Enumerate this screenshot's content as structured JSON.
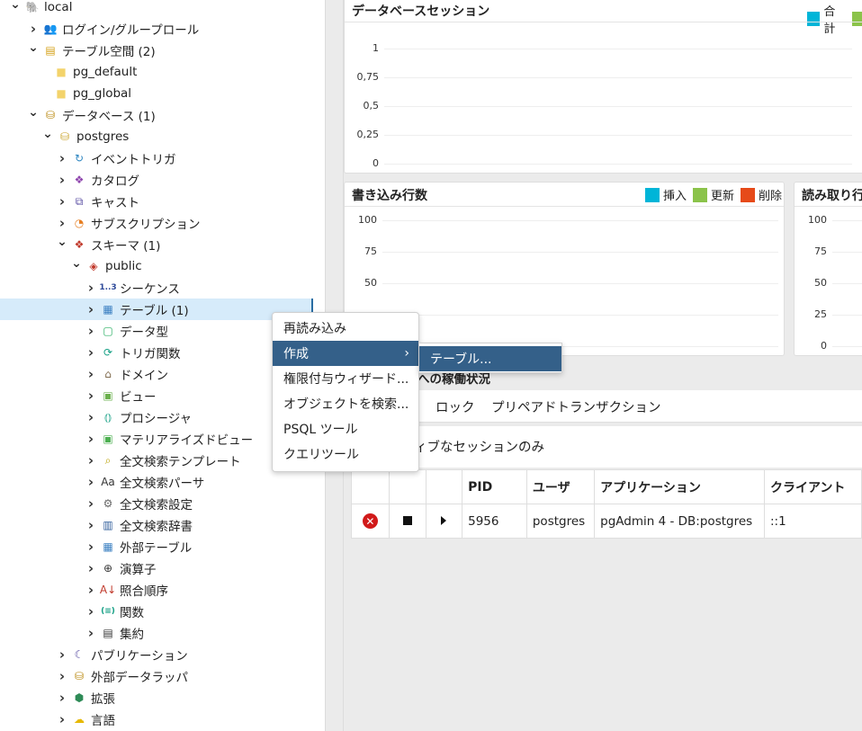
{
  "tree": {
    "items": [
      {
        "label": "local",
        "chev": "down",
        "icon": "postgres-elephant-icon",
        "glyph": "🐘",
        "color": "#336791",
        "indent": 10
      },
      {
        "label": "ログイン/グループロール",
        "chev": "right",
        "icon": "roles-icon",
        "glyph": "👥",
        "color": "#c0392b",
        "indent": 30
      },
      {
        "label": "テーブル空間 (2)",
        "chev": "down",
        "icon": "tablespaces-icon",
        "glyph": "▤",
        "color": "#d4a017",
        "indent": 30
      },
      {
        "label": "pg_default",
        "chev": "none",
        "icon": "folder-icon",
        "glyph": "■",
        "color": "#f3d36b",
        "indent": 42
      },
      {
        "label": "pg_global",
        "chev": "none",
        "icon": "folder-icon",
        "glyph": "■",
        "color": "#f3d36b",
        "indent": 42
      },
      {
        "label": "データベース (1)",
        "chev": "down",
        "icon": "databases-icon",
        "glyph": "⛁",
        "color": "#b8860b",
        "indent": 30
      },
      {
        "label": "postgres",
        "chev": "down",
        "icon": "database-icon",
        "glyph": "⛁",
        "color": "#c9a227",
        "indent": 46
      },
      {
        "label": "イベントトリガ",
        "chev": "right",
        "icon": "event-trigger-icon",
        "glyph": "↻",
        "color": "#2e86c1",
        "indent": 62
      },
      {
        "label": "カタログ",
        "chev": "right",
        "icon": "catalog-icon",
        "glyph": "❖",
        "color": "#8e44ad",
        "indent": 62
      },
      {
        "label": "キャスト",
        "chev": "right",
        "icon": "cast-icon",
        "glyph": "⧉",
        "color": "#5b4fa3",
        "indent": 62
      },
      {
        "label": "サブスクリプション",
        "chev": "right",
        "icon": "subscription-icon",
        "glyph": "◔",
        "color": "#e67e22",
        "indent": 62
      },
      {
        "label": "スキーマ (1)",
        "chev": "down",
        "icon": "schemas-icon",
        "glyph": "❖",
        "color": "#c0392b",
        "indent": 62
      },
      {
        "label": "public",
        "chev": "down",
        "icon": "schema-icon",
        "glyph": "◈",
        "color": "#c0392b",
        "indent": 78
      },
      {
        "label": "シーケンス",
        "chev": "right",
        "icon": "sequence-icon",
        "glyph": "1..3",
        "color": "#2e4a9a",
        "indent": 94
      },
      {
        "label": "テーブル (1)",
        "chev": "right",
        "icon": "table-icon",
        "glyph": "▦",
        "color": "#3a7fc1",
        "indent": 94,
        "selected": true
      },
      {
        "label": "データ型",
        "chev": "right",
        "icon": "datatype-icon",
        "glyph": "▢",
        "color": "#27ae60",
        "indent": 94
      },
      {
        "label": "トリガ関数",
        "chev": "right",
        "icon": "trigger-function-icon",
        "glyph": "⟳",
        "color": "#16a085",
        "indent": 94
      },
      {
        "label": "ドメイン",
        "chev": "right",
        "icon": "domain-icon",
        "glyph": "⌂",
        "color": "#7f6a4d",
        "indent": 94
      },
      {
        "label": "ビュー",
        "chev": "right",
        "icon": "view-icon",
        "glyph": "▣",
        "color": "#6ab04c",
        "indent": 94
      },
      {
        "label": "プロシージャ",
        "chev": "right",
        "icon": "procedure-icon",
        "glyph": "⦅⦆",
        "color": "#16a085",
        "indent": 94
      },
      {
        "label": "マテリアライズドビュー",
        "chev": "right",
        "icon": "materialized-view-icon",
        "glyph": "▣",
        "color": "#4caf50",
        "indent": 94
      },
      {
        "label": "全文検索テンプレート",
        "chev": "right",
        "icon": "fts-template-icon",
        "glyph": "⌕",
        "color": "#b9a000",
        "indent": 94
      },
      {
        "label": "全文検索パーサ",
        "chev": "right",
        "icon": "fts-parser-icon",
        "glyph": "Aa",
        "color": "#333333",
        "indent": 94
      },
      {
        "label": "全文検索設定",
        "chev": "right",
        "icon": "fts-config-icon",
        "glyph": "⚙",
        "color": "#666666",
        "indent": 94
      },
      {
        "label": "全文検索辞書",
        "chev": "right",
        "icon": "fts-dictionary-icon",
        "glyph": "▥",
        "color": "#2e5c9a",
        "indent": 94
      },
      {
        "label": "外部テーブル",
        "chev": "right",
        "icon": "foreign-table-icon",
        "glyph": "▦",
        "color": "#3a7fc1",
        "indent": 94
      },
      {
        "label": "演算子",
        "chev": "right",
        "icon": "operator-icon",
        "glyph": "⊕",
        "color": "#333333",
        "indent": 94
      },
      {
        "label": "照合順序",
        "chev": "right",
        "icon": "collation-icon",
        "glyph": "A↓",
        "color": "#c0392b",
        "indent": 94
      },
      {
        "label": "関数",
        "chev": "right",
        "icon": "function-icon",
        "glyph": "(≡)",
        "color": "#16a085",
        "indent": 94
      },
      {
        "label": "集約",
        "chev": "right",
        "icon": "aggregate-icon",
        "glyph": "▤",
        "color": "#333333",
        "indent": 94
      },
      {
        "label": "パブリケーション",
        "chev": "right",
        "icon": "publication-icon",
        "glyph": "☾",
        "color": "#5b4fa3",
        "indent": 62
      },
      {
        "label": "外部データラッパ",
        "chev": "right",
        "icon": "fdw-icon",
        "glyph": "⛁",
        "color": "#b8860b",
        "indent": 62
      },
      {
        "label": "拡張",
        "chev": "right",
        "icon": "extension-icon",
        "glyph": "⬢",
        "color": "#2e8b57",
        "indent": 62
      },
      {
        "label": "言語",
        "chev": "right",
        "icon": "language-icon",
        "glyph": "☁",
        "color": "#e6b800",
        "indent": 62
      }
    ]
  },
  "panels": {
    "sessions": {
      "title": "データベースセッション",
      "legend": [
        {
          "label": "合計",
          "color": "#00b5d8"
        },
        {
          "label": "",
          "color": "#8bc34a"
        }
      ],
      "ticks": [
        "1",
        "0,75",
        "0,5",
        "0,25",
        "0"
      ]
    },
    "writes": {
      "title": "書き込み行数",
      "legend": [
        {
          "label": "挿入",
          "color": "#00b5d8"
        },
        {
          "label": "更新",
          "color": "#8bc34a"
        },
        {
          "label": "削除",
          "color": "#e64a19"
        }
      ],
      "ticks": [
        "100",
        "75",
        "50",
        "",
        ""
      ]
    },
    "reads": {
      "title": "読み取り行",
      "ticks": [
        "100",
        "75",
        "50",
        "25",
        "0"
      ]
    }
  },
  "activity": {
    "title": "への稼働状況",
    "tabs": [
      "ロック",
      "プリペアドトランザクション"
    ],
    "filter": "ィブなセッションのみ",
    "columns": [
      "",
      "",
      "",
      "PID",
      "ユーザ",
      "アプリケーション",
      "クライアント"
    ],
    "rows": [
      {
        "pid": "5956",
        "user": "postgres",
        "app": "pgAdmin 4 - DB:postgres",
        "client": "::1"
      }
    ]
  },
  "context_menu": {
    "items": [
      "再読み込み",
      "作成",
      "権限付与ウィザード...",
      "オブジェクトを検索...",
      "PSQL ツール",
      "クエリツール"
    ],
    "submenu": [
      "テーブル..."
    ]
  }
}
